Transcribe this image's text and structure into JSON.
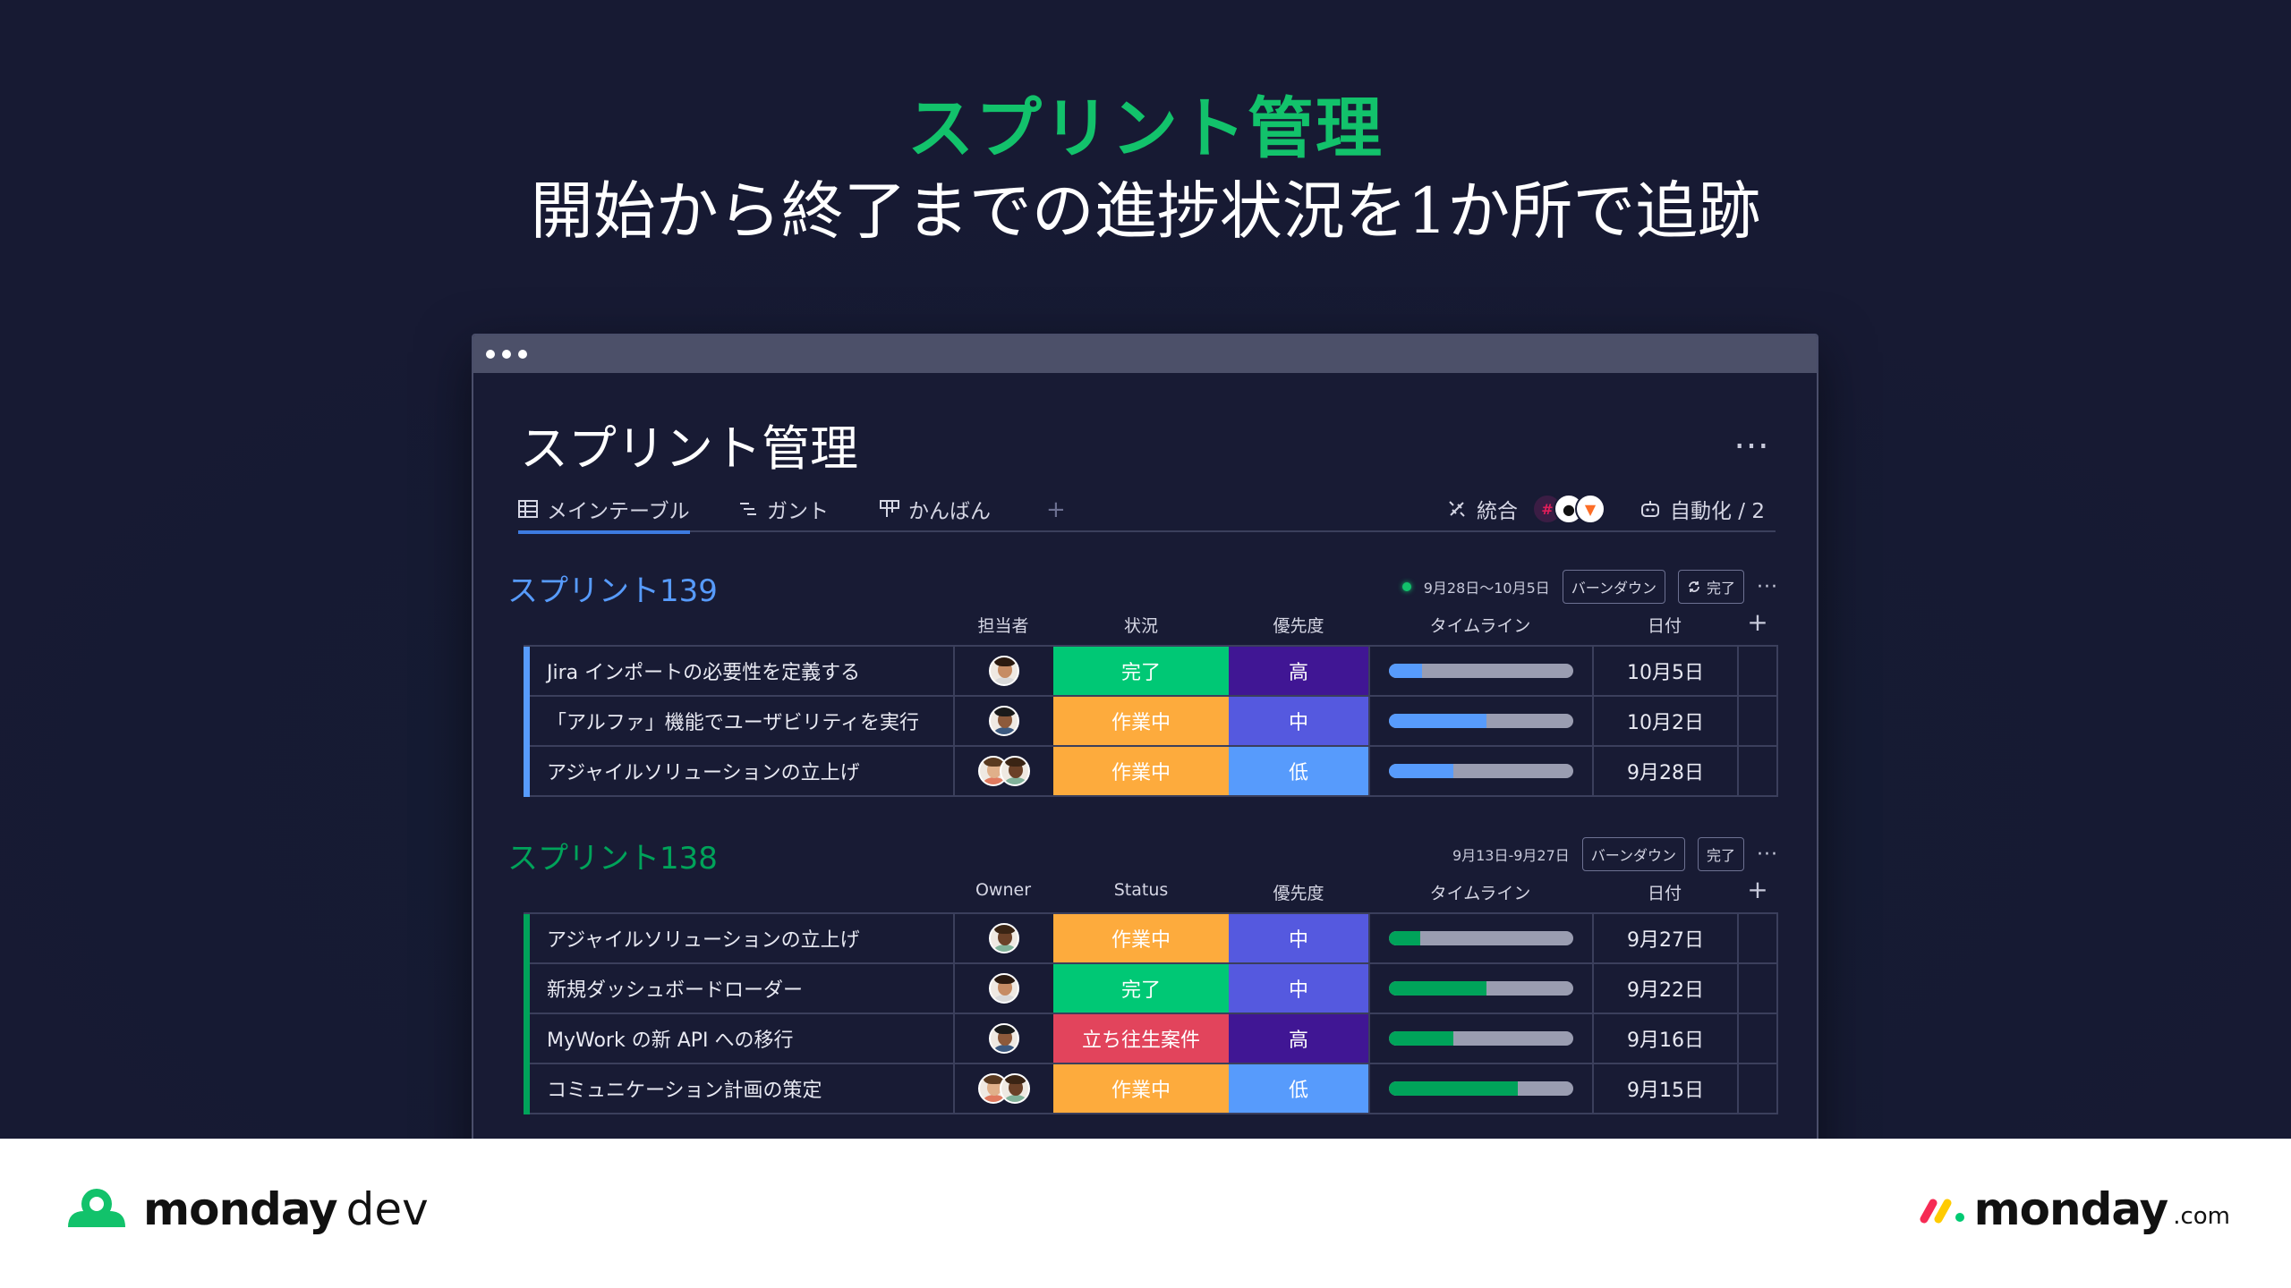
{
  "hero": {
    "title": "スプリント管理",
    "subtitle": "開始から終了までの進捗状況を1か所で追跡"
  },
  "board": {
    "title": "スプリント管理",
    "more_icon": "…",
    "tabs": [
      {
        "label": "メインテーブル",
        "icon": "table-icon",
        "active": true
      },
      {
        "label": "ガント",
        "icon": "gantt-icon",
        "active": false
      },
      {
        "label": "かんばん",
        "icon": "kanban-icon",
        "active": false
      }
    ],
    "add_view": "+",
    "integrate_label": "統合",
    "automate_label": "自動化 / 2"
  },
  "colors": {
    "green": "#00c875",
    "orange": "#fdab3d",
    "red": "#e2445c",
    "priority_high": "#401694",
    "priority_mid": "#5559df",
    "priority_low": "#579bfc",
    "sprint139": "#579bfc",
    "sprint138": "#00a35a"
  },
  "groups": [
    {
      "name": "スプリント139",
      "date_range": "9月28日〜10月5日",
      "burndown_label": "バーンダウン",
      "done_label": "完了",
      "more": "···",
      "columns": {
        "owner": "担当者",
        "status": "状況",
        "priority": "優先度",
        "timeline": "タイムライン",
        "date": "日付",
        "add": "+"
      },
      "rows": [
        {
          "name": "Jira インポートの必要性を定義する",
          "owners": 1,
          "status": "完了",
          "status_color": "#00c875",
          "priority": "高",
          "priority_color": "#401694",
          "progress": 0.18,
          "date": "10月5日"
        },
        {
          "name": "「アルファ」機能でユーザビリティを実行",
          "owners": 1,
          "status": "作業中",
          "status_color": "#fdab3d",
          "priority": "中",
          "priority_color": "#5559df",
          "progress": 0.53,
          "date": "10月2日"
        },
        {
          "name": "アジャイルソリューションの立上げ",
          "owners": 2,
          "status": "作業中",
          "status_color": "#fdab3d",
          "priority": "低",
          "priority_color": "#579bfc",
          "progress": 0.35,
          "date": "9月28日"
        }
      ]
    },
    {
      "name": "スプリント138",
      "date_range": "9月13日-9月27日",
      "burndown_label": "バーンダウン",
      "done_label": "完了",
      "more": "···",
      "columns": {
        "owner": "Owner",
        "status": "Status",
        "priority": "優先度",
        "timeline": "タイムライン",
        "date": "日付",
        "add": "+"
      },
      "rows": [
        {
          "name": "アジャイルソリューションの立上げ",
          "owners": 1,
          "status": "作業中",
          "status_color": "#fdab3d",
          "priority": "中",
          "priority_color": "#5559df",
          "progress": 0.17,
          "date": "9月27日"
        },
        {
          "name": "新規ダッシュボードローダー",
          "owners": 1,
          "status": "完了",
          "status_color": "#00c875",
          "priority": "中",
          "priority_color": "#5559df",
          "progress": 0.53,
          "date": "9月22日"
        },
        {
          "name": "MyWork の新 API への移行",
          "owners": 1,
          "status": "立ち往生案件",
          "status_color": "#e2445c",
          "priority": "高",
          "priority_color": "#401694",
          "progress": 0.35,
          "date": "9月16日"
        },
        {
          "name": "コミュニケーション計画の策定",
          "owners": 2,
          "status": "作業中",
          "status_color": "#fdab3d",
          "priority": "低",
          "priority_color": "#579bfc",
          "progress": 0.7,
          "date": "9月15日"
        }
      ]
    }
  ],
  "footer": {
    "left_brand": "monday",
    "left_product": "dev",
    "right_brand": "monday",
    "right_tld": ".com"
  }
}
